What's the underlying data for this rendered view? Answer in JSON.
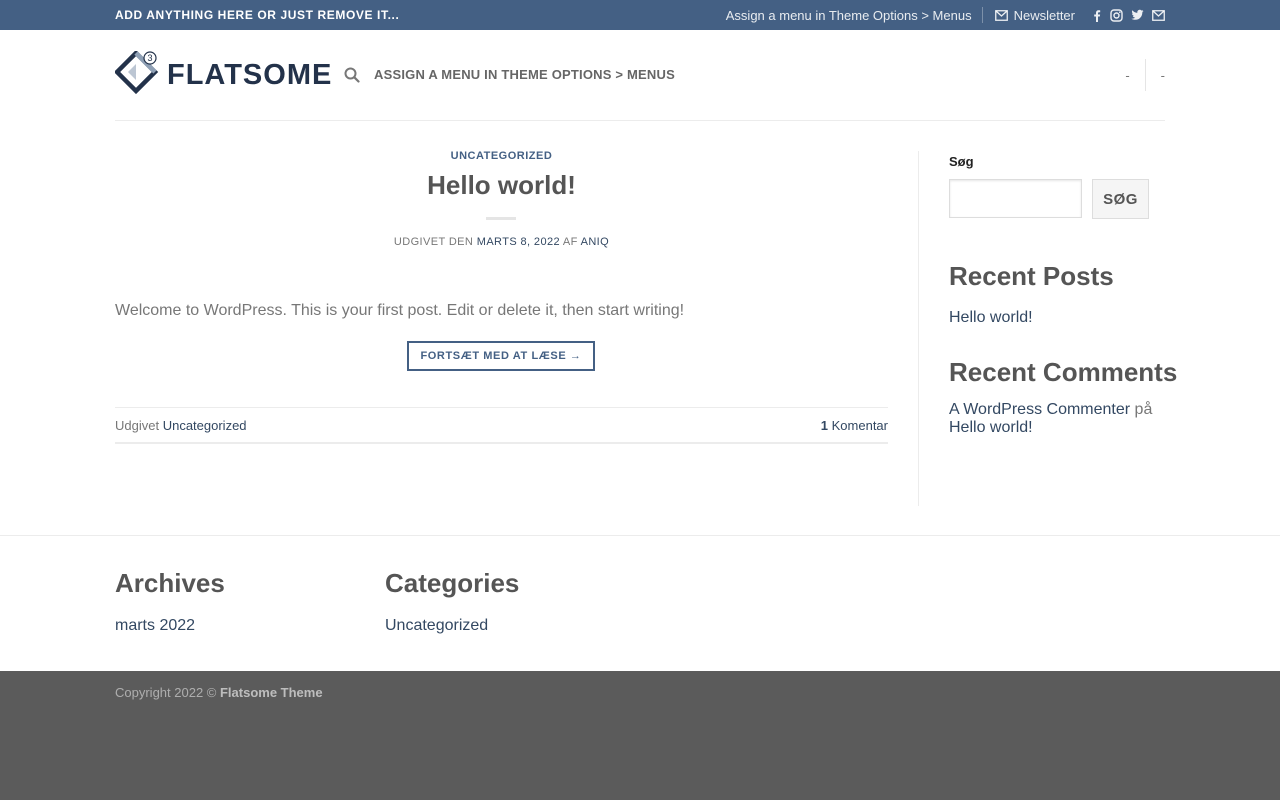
{
  "topbar": {
    "left_text": "ADD ANYTHING HERE OR JUST REMOVE IT...",
    "menu_link": "Assign a menu in Theme Options > Menus",
    "newsletter": "Newsletter",
    "social_icons": [
      "facebook-icon",
      "instagram-icon",
      "twitter-icon",
      "envelope-icon"
    ]
  },
  "header": {
    "logo_text": "FLATSOME",
    "logo_badge": "3",
    "nav_text": "ASSIGN A MENU IN THEME OPTIONS > MENUS",
    "right_items": [
      "-",
      "-"
    ]
  },
  "post": {
    "category": "UNCATEGORIZED",
    "title": "Hello world!",
    "meta_prefix": "UDGIVET DEN",
    "meta_date": "MARTS 8, 2022",
    "meta_by": "AF",
    "meta_author": "ANIQ",
    "excerpt": "Welcome to WordPress. This is your first post. Edit or delete it, then start writing!",
    "read_more": "FORTSÆT MED AT LÆSE →",
    "footer_prefix": "Udgivet",
    "footer_category": "Uncategorized",
    "comment_count": "1",
    "comment_label": "Komentar"
  },
  "sidebar": {
    "search_label": "Søg",
    "search_placeholder": "",
    "search_button": "SØG",
    "recent_posts_title": "Recent Posts",
    "recent_posts": [
      "Hello world!"
    ],
    "recent_comments_title": "Recent Comments",
    "comment_author": "A WordPress Commenter",
    "comment_on": "på",
    "comment_post": "Hello world!"
  },
  "footer_widgets": {
    "archives_title": "Archives",
    "archives": [
      "marts 2022"
    ],
    "categories_title": "Categories",
    "categories": [
      "Uncategorized"
    ]
  },
  "footer": {
    "copyright_prefix": "Copyright 2022 ©",
    "copyright_brand": "Flatsome Theme"
  },
  "colors": {
    "topbar_bg": "#446084",
    "link": "#334862",
    "footer_bg": "#5b5b5b"
  }
}
